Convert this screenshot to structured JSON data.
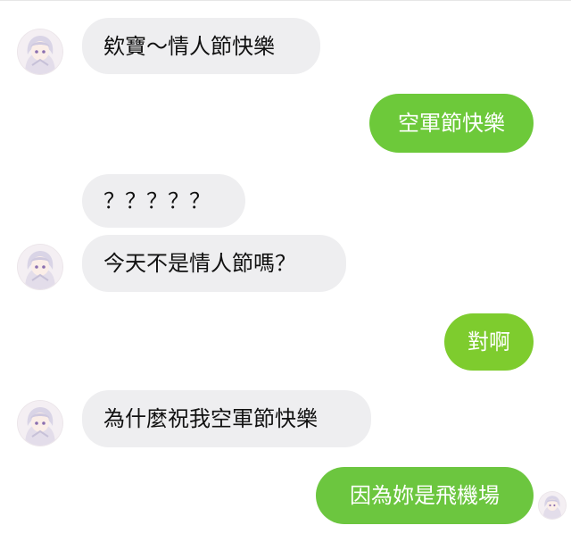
{
  "messages": [
    {
      "side": "received",
      "text": "欸寶～情人節快樂",
      "avatar": "anime-girl-avatar"
    },
    {
      "side": "sent",
      "text": "空軍節快樂"
    },
    {
      "side": "received",
      "text": "？？？？？"
    },
    {
      "side": "received",
      "text": "今天不是情人節嗎？",
      "avatar": "anime-girl-avatar"
    },
    {
      "side": "sent",
      "text": "對啊"
    },
    {
      "side": "received",
      "text": "為什麼祝我空軍節快樂",
      "avatar": "anime-girl-avatar"
    },
    {
      "side": "sent",
      "text": "因為妳是飛機場",
      "avatar": "anime-girl-avatar"
    }
  ],
  "colors": {
    "received_bubble": "#eeeef0",
    "sent_bubble": "#79cc34",
    "received_text": "#111111",
    "sent_text": "#ffffff"
  }
}
